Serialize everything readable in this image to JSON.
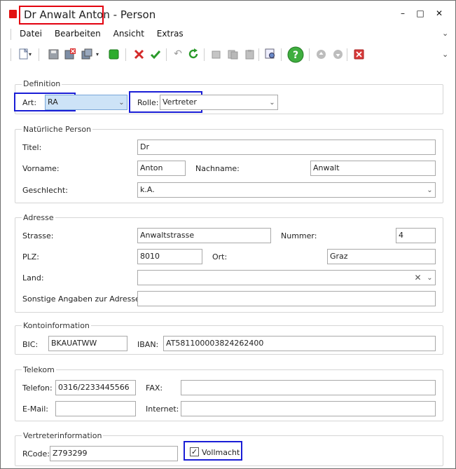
{
  "window": {
    "title_name": "Dr Anwalt Anton",
    "title_suffix": "- Person",
    "minimize": "–",
    "maximize": "□",
    "close": "✕"
  },
  "menu": [
    "Datei",
    "Bearbeiten",
    "Ansicht",
    "Extras"
  ],
  "toolbar": {
    "icons": [
      "new-doc-icon",
      "save-icon",
      "save-close-icon",
      "save-as-icon",
      "green-square-icon",
      "cancel-icon",
      "confirm-icon",
      "undo-icon",
      "refresh-icon",
      "cut-icon",
      "copy-icon",
      "paste-icon",
      "preview-icon",
      "help-icon",
      "move-up-icon",
      "move-down-icon",
      "delete-icon"
    ]
  },
  "definition": {
    "group_label": "Definition",
    "art_label": "Art:",
    "art_value": "RA",
    "rolle_label": "Rolle:",
    "rolle_value": "Vertreter"
  },
  "person": {
    "group_label": "Natürliche Person",
    "titel_label": "Titel:",
    "titel_value": "Dr",
    "vorname_label": "Vorname:",
    "vorname_value": "Anton",
    "nachname_label": "Nachname:",
    "nachname_value": "Anwalt",
    "geschlecht_label": "Geschlecht:",
    "geschlecht_value": "k.A."
  },
  "adresse": {
    "group_label": "Adresse",
    "strasse_label": "Strasse:",
    "strasse_value": "Anwaltstrasse",
    "nummer_label": "Nummer:",
    "nummer_value": "4",
    "plz_label": "PLZ:",
    "plz_value": "8010",
    "ort_label": "Ort:",
    "ort_value": "Graz",
    "land_label": "Land:",
    "land_value": "",
    "sonstige_label": "Sonstige Angaben zur Adresse:",
    "sonstige_value": ""
  },
  "konto": {
    "group_label": "Kontoinformation",
    "bic_label": "BIC:",
    "bic_value": "BKAUATWW",
    "iban_label": "IBAN:",
    "iban_value": "AT581100003824262400"
  },
  "telekom": {
    "group_label": "Telekom",
    "telefon_label": "Telefon:",
    "telefon_value": "0316/2233445566",
    "fax_label": "FAX:",
    "fax_value": "",
    "email_label": "E-Mail:",
    "email_value": "",
    "internet_label": "Internet:",
    "internet_value": ""
  },
  "vertreter": {
    "group_label": "Vertreterinformation",
    "rcode_label": "RCode:",
    "rcode_value": "Z793299",
    "vollmacht_label": "Vollmacht",
    "vollmacht_checked": "✓"
  },
  "colors": {
    "highlight_red": "#e3000f",
    "highlight_blue": "#1a1ed6",
    "selected_bg": "#cde3f7"
  }
}
